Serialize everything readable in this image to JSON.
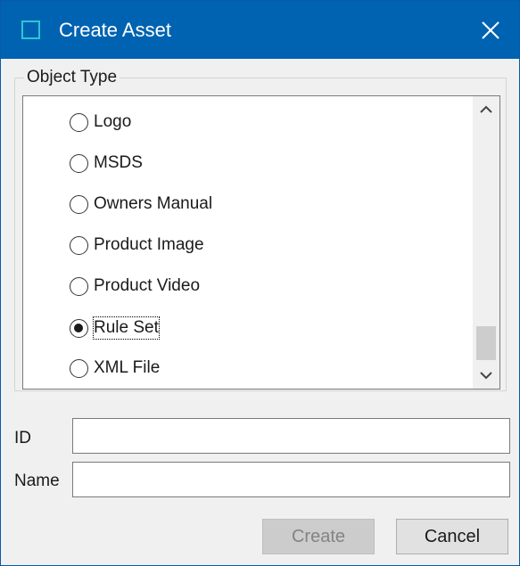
{
  "window": {
    "title": "Create Asset",
    "accent_color": "#0063b1",
    "icon": "window-app-icon",
    "close_icon": "close-icon"
  },
  "object_type": {
    "label": "Object Type",
    "options": [
      {
        "label": "Logo",
        "checked": false
      },
      {
        "label": "MSDS",
        "checked": false
      },
      {
        "label": "Owners Manual",
        "checked": false
      },
      {
        "label": "Product Image",
        "checked": false
      },
      {
        "label": "Product Video",
        "checked": false
      },
      {
        "label": "Rule Set",
        "checked": true
      },
      {
        "label": "XML File",
        "checked": false
      }
    ],
    "selected": "Rule Set",
    "scroll_up_icon": "chevron-up-icon",
    "scroll_down_icon": "chevron-down-icon"
  },
  "fields": {
    "id_label": "ID",
    "id_value": "",
    "name_label": "Name",
    "name_value": ""
  },
  "buttons": {
    "create_label": "Create",
    "create_enabled": false,
    "cancel_label": "Cancel"
  }
}
